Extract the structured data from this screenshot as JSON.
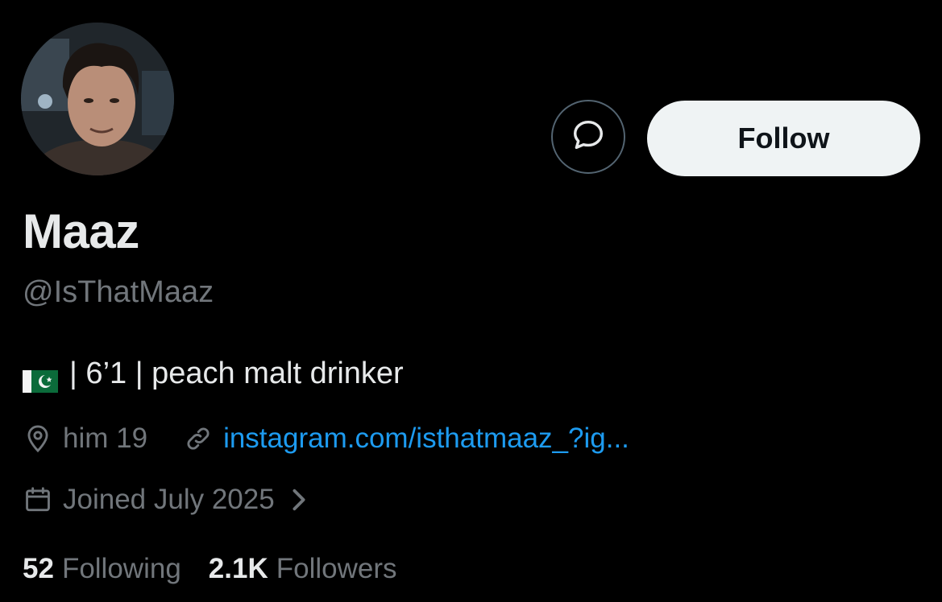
{
  "profile": {
    "display_name": "Maaz",
    "handle": "@IsThatMaaz",
    "bio": "| 6’1 | peach malt drinker",
    "bio_flag_icon": "pakistan-flag-icon",
    "location": "him 19",
    "link": "instagram.com/isthatmaaz_?ig...",
    "joined": "Joined July 2025"
  },
  "actions": {
    "message_icon": "message-bubble-icon",
    "follow_label": "Follow"
  },
  "stats": {
    "following_count": "52",
    "following_label": "Following",
    "followers_count": "2.1K",
    "followers_label": "Followers"
  },
  "colors": {
    "background": "#000000",
    "primary_text": "#e7e9ea",
    "secondary_text": "#71767b",
    "link": "#1d9bf0",
    "follow_bg": "#eff3f4",
    "follow_text": "#0f1419"
  }
}
